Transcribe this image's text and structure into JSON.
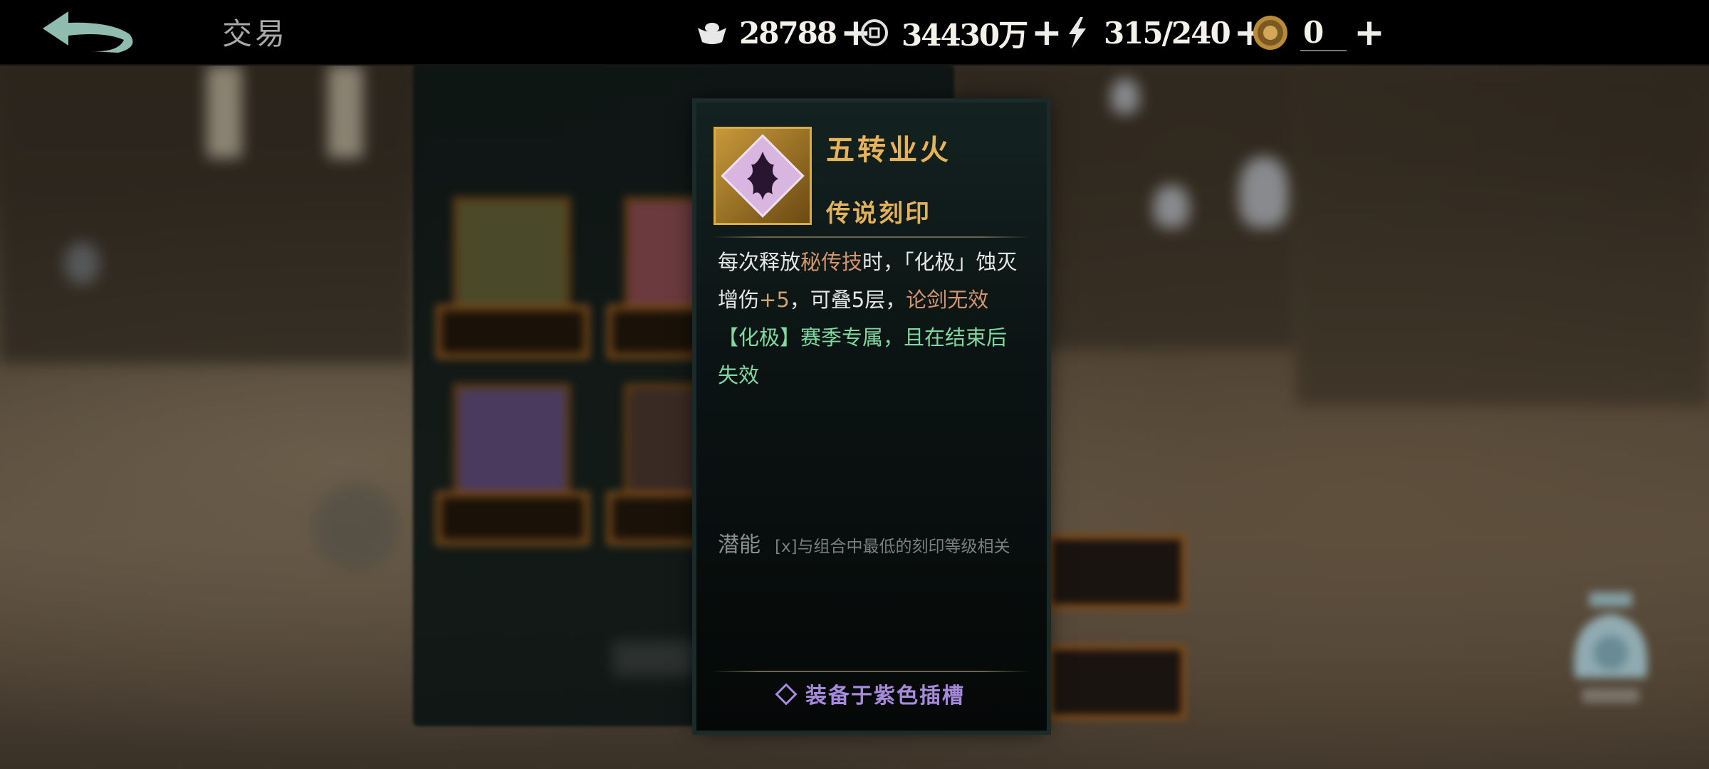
{
  "header": {
    "title": "交易",
    "resources": [
      {
        "icon": "silver-ingot-icon",
        "value": "28788"
      },
      {
        "icon": "copper-coin-icon",
        "value": "34430万"
      },
      {
        "icon": "lightning-stamina-icon",
        "value": "315/240"
      },
      {
        "icon": "gold-medallion-icon",
        "value": "0"
      }
    ]
  },
  "tooltip": {
    "name": "五转业火",
    "rarity": "传说刻印",
    "desc": {
      "p1": "每次释放",
      "kw1": "秘传技",
      "p2": "时，「化极」蚀灭增伤",
      "num1": "+5",
      "p3": "，可叠5层，",
      "kw2": "论剑无效",
      "season": "【化极】赛季专属，且在结束后失效"
    },
    "potential_label": "潜能",
    "potential_note": "[x]与组合中最低的刻印等级相关",
    "equip_text": "装备于紫色插槽"
  },
  "colors": {
    "accent_gold": "#e7b25a",
    "keyword": "#d4946e",
    "season_green": "#7fd8a0",
    "equip_purple": "#a78adb"
  }
}
